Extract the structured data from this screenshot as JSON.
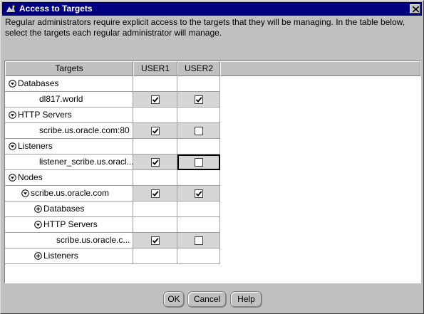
{
  "window": {
    "title": "Access to Targets",
    "icon": "app-icon"
  },
  "instructions": "Regular administrators require explicit access to the targets that they will be managing. In the table below, select the targets each regular administrator will manage.",
  "table": {
    "headers": {
      "targets": "Targets",
      "user1": "USER1",
      "user2": "USER2"
    },
    "rows": [
      {
        "label": "Databases",
        "kind": "group",
        "toggle": "expanded"
      },
      {
        "label": "dl817.world",
        "kind": "child",
        "user1": true,
        "user2": true
      },
      {
        "label": "HTTP Servers",
        "kind": "group",
        "toggle": "expanded"
      },
      {
        "label": "scribe.us.oracle.com:80",
        "kind": "child",
        "user1": true,
        "user2": false
      },
      {
        "label": "Listeners",
        "kind": "group",
        "toggle": "expanded"
      },
      {
        "label": "listener_scribe.us.oracl...",
        "kind": "child",
        "user1": true,
        "user2": false,
        "focused": "user2"
      },
      {
        "label": "Nodes",
        "kind": "group",
        "toggle": "expanded"
      },
      {
        "label": "scribe.us.oracle.com",
        "kind": "child",
        "toggle": "expanded",
        "user1": true,
        "user2": true
      },
      {
        "label": "Databases",
        "kind": "group",
        "toggle": "collapsed"
      },
      {
        "label": "HTTP Servers",
        "kind": "group",
        "toggle": "expanded"
      },
      {
        "label": "scribe.us.oracle.c...",
        "kind": "child",
        "user1": true,
        "user2": false
      },
      {
        "label": "Listeners",
        "kind": "group",
        "toggle": "collapsed"
      }
    ]
  },
  "buttons": {
    "ok": "OK",
    "cancel": "Cancel",
    "help": "Help"
  },
  "colors": {
    "titlebar": "#000080",
    "dialog": "#c0c0c0",
    "child_check_cell": "#d6d6d6"
  }
}
